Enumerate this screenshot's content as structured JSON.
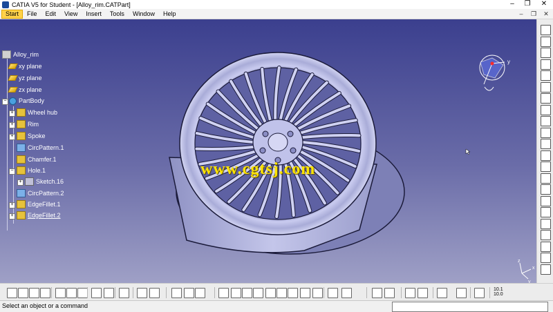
{
  "window": {
    "title": "CATIA V5 for Student - [Alloy_rim.CATPart]",
    "minimize": "–",
    "maximize": "❐",
    "close": "✕"
  },
  "menu": {
    "items": [
      "Start",
      "File",
      "Edit",
      "View",
      "Insert",
      "Tools",
      "Window",
      "Help"
    ],
    "doc_controls": [
      "–",
      "❐",
      "✕"
    ]
  },
  "tree": {
    "root": "Alloy_rim",
    "planes": [
      "xy plane",
      "yz plane",
      "zx plane"
    ],
    "body": "PartBody",
    "features": [
      {
        "label": "Wheel hub",
        "icon": "feature-icon"
      },
      {
        "label": "Rim",
        "icon": "feature-icon"
      },
      {
        "label": "Spoke",
        "icon": "feature-icon"
      },
      {
        "label": "CircPattern.1",
        "icon": "pattern-icon"
      },
      {
        "label": "Chamfer.1",
        "icon": "feature-icon"
      },
      {
        "label": "Hole.1",
        "icon": "feature-icon"
      },
      {
        "label": "Sketch.16",
        "icon": "sketch-icon"
      },
      {
        "label": "CircPattern.2",
        "icon": "pattern-icon"
      },
      {
        "label": "EdgeFillet.1",
        "icon": "feature-icon"
      },
      {
        "label": "EdgeFillet.2",
        "icon": "feature-icon"
      }
    ]
  },
  "compass": {
    "x_label": "x",
    "y_label": "y",
    "z_label": "z"
  },
  "watermark": "www.cgtsj.com",
  "logo_text": "CATIA",
  "bottom_toolbar": {
    "view_scale": "10.1\n10.0"
  },
  "status": {
    "message": "Select an object or a command",
    "command_value": ""
  },
  "colors": {
    "viewport_top": "#3b3f8e",
    "viewport_bottom": "#9fa0c6",
    "model": "#b8bbe4",
    "accent": "#ffd24a"
  }
}
